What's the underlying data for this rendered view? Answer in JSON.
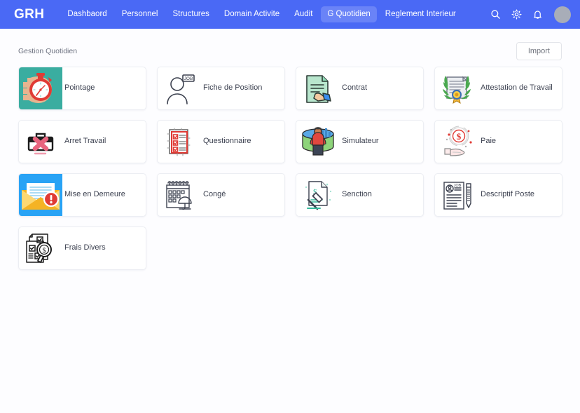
{
  "navbar": {
    "logo": "GRH",
    "links": [
      {
        "label": "Dashbaord",
        "active": false
      },
      {
        "label": "Personnel",
        "active": false
      },
      {
        "label": "Structures",
        "active": false
      },
      {
        "label": "Domain Activite",
        "active": false
      },
      {
        "label": "Audit",
        "active": false
      },
      {
        "label": "G Quotidien",
        "active": true
      },
      {
        "label": "Reglement Interieur",
        "active": false
      }
    ],
    "icons": [
      "search-icon",
      "gear-icon",
      "bell-icon"
    ],
    "avatar": "user-avatar",
    "background_color": "#4a69f5",
    "active_pill_color": "#6a83f7"
  },
  "page": {
    "title": "Gestion Quotidien",
    "import_label": "Import"
  },
  "cards": [
    {
      "label": "Pointage",
      "icon": "stopwatch-hand-icon",
      "bg": "#3aada0"
    },
    {
      "label": "Fiche de Position",
      "icon": "person-job-badge-icon",
      "bg": "#ffffff"
    },
    {
      "label": "Contrat",
      "icon": "contract-handshake-icon",
      "bg": "#ffffff"
    },
    {
      "label": "Attestation de Travail",
      "icon": "certificate-laurel-icon",
      "bg": "#ffffff"
    },
    {
      "label": "Arret Travail",
      "icon": "briefcase-cross-icon",
      "bg": "#ffffff"
    },
    {
      "label": "Questionnaire",
      "icon": "checklist-clipboard-icon",
      "bg": "#ffffff"
    },
    {
      "label": "Simulateur",
      "icon": "person-data-cylinder-icon",
      "bg": "#ffffff"
    },
    {
      "label": "Paie",
      "icon": "hand-coin-dollar-icon",
      "bg": "#ffffff"
    },
    {
      "label": "Mise en Demeure",
      "icon": "envelope-alert-icon",
      "bg": "#29a3f5"
    },
    {
      "label": "Congé",
      "icon": "calendar-umbrella-icon",
      "bg": "#ffffff"
    },
    {
      "label": "Senction",
      "icon": "document-gavel-icon",
      "bg": "#ffffff"
    },
    {
      "label": "Descriptif Poste",
      "icon": "resume-pencil-icon",
      "bg": "#ffffff"
    },
    {
      "label": "Frais Divers",
      "icon": "checklist-magnifier-dollar-icon",
      "bg": "#ffffff"
    }
  ]
}
